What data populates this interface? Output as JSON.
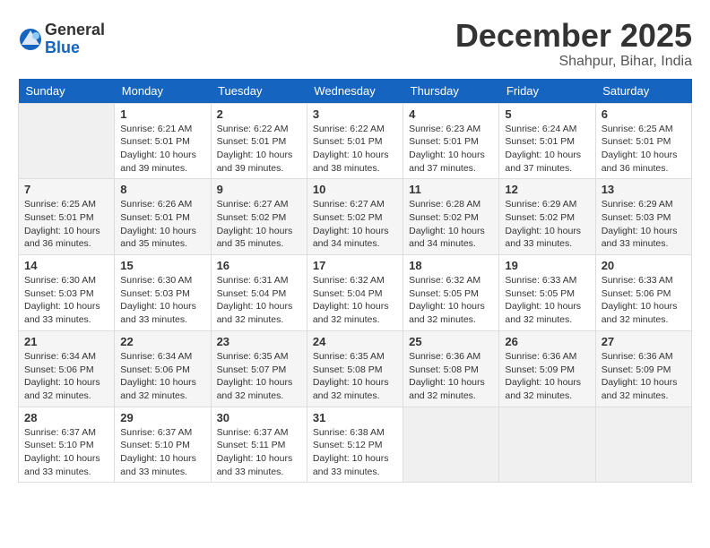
{
  "header": {
    "logo_general": "General",
    "logo_blue": "Blue",
    "month": "December 2025",
    "location": "Shahpur, Bihar, India"
  },
  "weekdays": [
    "Sunday",
    "Monday",
    "Tuesday",
    "Wednesday",
    "Thursday",
    "Friday",
    "Saturday"
  ],
  "weeks": [
    [
      {
        "day": "",
        "empty": true
      },
      {
        "day": "1",
        "sunrise": "6:21 AM",
        "sunset": "5:01 PM",
        "daylight": "10 hours and 39 minutes."
      },
      {
        "day": "2",
        "sunrise": "6:22 AM",
        "sunset": "5:01 PM",
        "daylight": "10 hours and 39 minutes."
      },
      {
        "day": "3",
        "sunrise": "6:22 AM",
        "sunset": "5:01 PM",
        "daylight": "10 hours and 38 minutes."
      },
      {
        "day": "4",
        "sunrise": "6:23 AM",
        "sunset": "5:01 PM",
        "daylight": "10 hours and 37 minutes."
      },
      {
        "day": "5",
        "sunrise": "6:24 AM",
        "sunset": "5:01 PM",
        "daylight": "10 hours and 37 minutes."
      },
      {
        "day": "6",
        "sunrise": "6:25 AM",
        "sunset": "5:01 PM",
        "daylight": "10 hours and 36 minutes."
      }
    ],
    [
      {
        "day": "7",
        "sunrise": "6:25 AM",
        "sunset": "5:01 PM",
        "daylight": "10 hours and 36 minutes."
      },
      {
        "day": "8",
        "sunrise": "6:26 AM",
        "sunset": "5:01 PM",
        "daylight": "10 hours and 35 minutes."
      },
      {
        "day": "9",
        "sunrise": "6:27 AM",
        "sunset": "5:02 PM",
        "daylight": "10 hours and 35 minutes."
      },
      {
        "day": "10",
        "sunrise": "6:27 AM",
        "sunset": "5:02 PM",
        "daylight": "10 hours and 34 minutes."
      },
      {
        "day": "11",
        "sunrise": "6:28 AM",
        "sunset": "5:02 PM",
        "daylight": "10 hours and 34 minutes."
      },
      {
        "day": "12",
        "sunrise": "6:29 AM",
        "sunset": "5:02 PM",
        "daylight": "10 hours and 33 minutes."
      },
      {
        "day": "13",
        "sunrise": "6:29 AM",
        "sunset": "5:03 PM",
        "daylight": "10 hours and 33 minutes."
      }
    ],
    [
      {
        "day": "14",
        "sunrise": "6:30 AM",
        "sunset": "5:03 PM",
        "daylight": "10 hours and 33 minutes."
      },
      {
        "day": "15",
        "sunrise": "6:30 AM",
        "sunset": "5:03 PM",
        "daylight": "10 hours and 33 minutes."
      },
      {
        "day": "16",
        "sunrise": "6:31 AM",
        "sunset": "5:04 PM",
        "daylight": "10 hours and 32 minutes."
      },
      {
        "day": "17",
        "sunrise": "6:32 AM",
        "sunset": "5:04 PM",
        "daylight": "10 hours and 32 minutes."
      },
      {
        "day": "18",
        "sunrise": "6:32 AM",
        "sunset": "5:05 PM",
        "daylight": "10 hours and 32 minutes."
      },
      {
        "day": "19",
        "sunrise": "6:33 AM",
        "sunset": "5:05 PM",
        "daylight": "10 hours and 32 minutes."
      },
      {
        "day": "20",
        "sunrise": "6:33 AM",
        "sunset": "5:06 PM",
        "daylight": "10 hours and 32 minutes."
      }
    ],
    [
      {
        "day": "21",
        "sunrise": "6:34 AM",
        "sunset": "5:06 PM",
        "daylight": "10 hours and 32 minutes."
      },
      {
        "day": "22",
        "sunrise": "6:34 AM",
        "sunset": "5:06 PM",
        "daylight": "10 hours and 32 minutes."
      },
      {
        "day": "23",
        "sunrise": "6:35 AM",
        "sunset": "5:07 PM",
        "daylight": "10 hours and 32 minutes."
      },
      {
        "day": "24",
        "sunrise": "6:35 AM",
        "sunset": "5:08 PM",
        "daylight": "10 hours and 32 minutes."
      },
      {
        "day": "25",
        "sunrise": "6:36 AM",
        "sunset": "5:08 PM",
        "daylight": "10 hours and 32 minutes."
      },
      {
        "day": "26",
        "sunrise": "6:36 AM",
        "sunset": "5:09 PM",
        "daylight": "10 hours and 32 minutes."
      },
      {
        "day": "27",
        "sunrise": "6:36 AM",
        "sunset": "5:09 PM",
        "daylight": "10 hours and 32 minutes."
      }
    ],
    [
      {
        "day": "28",
        "sunrise": "6:37 AM",
        "sunset": "5:10 PM",
        "daylight": "10 hours and 33 minutes."
      },
      {
        "day": "29",
        "sunrise": "6:37 AM",
        "sunset": "5:10 PM",
        "daylight": "10 hours and 33 minutes."
      },
      {
        "day": "30",
        "sunrise": "6:37 AM",
        "sunset": "5:11 PM",
        "daylight": "10 hours and 33 minutes."
      },
      {
        "day": "31",
        "sunrise": "6:38 AM",
        "sunset": "5:12 PM",
        "daylight": "10 hours and 33 minutes."
      },
      {
        "day": "",
        "empty": true
      },
      {
        "day": "",
        "empty": true
      },
      {
        "day": "",
        "empty": true
      }
    ]
  ],
  "labels": {
    "sunrise": "Sunrise:",
    "sunset": "Sunset:",
    "daylight": "Daylight:"
  }
}
